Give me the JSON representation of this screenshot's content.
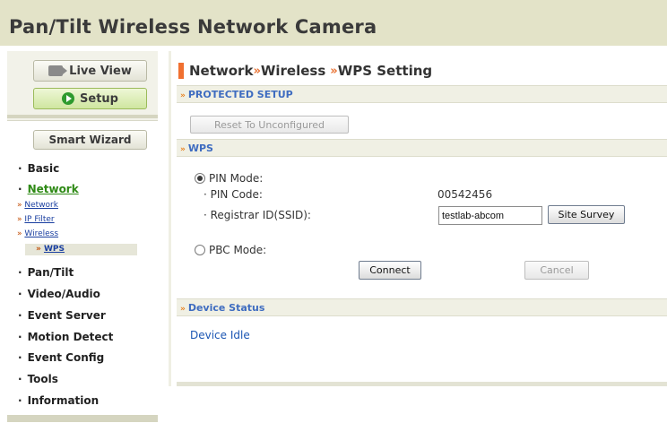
{
  "header": {
    "title": "Pan/Tilt Wireless Network Camera"
  },
  "sidebar": {
    "live_view": "Live View",
    "setup": "Setup",
    "smart_wizard": "Smart Wizard",
    "items": [
      {
        "label": "Basic"
      },
      {
        "label": "Network"
      },
      {
        "label": "Pan/Tilt"
      },
      {
        "label": "Video/Audio"
      },
      {
        "label": "Event Server"
      },
      {
        "label": "Motion Detect"
      },
      {
        "label": "Event Config"
      },
      {
        "label": "Tools"
      },
      {
        "label": "Information"
      }
    ],
    "bullet": "·",
    "sub_arrow": "»",
    "network_sub": [
      {
        "label": "Network"
      },
      {
        "label": "IP Filter"
      },
      {
        "label": "Wireless"
      }
    ],
    "wps": "WPS"
  },
  "main": {
    "breadcrumb": {
      "a": "Network",
      "b": "Wireless",
      "c": "WPS Setting",
      "sep": "»"
    },
    "sections": {
      "protected": "PROTECTED SETUP",
      "wps": "WPS",
      "device_status": "Device Status",
      "arrow": "»"
    },
    "reset_button": "Reset To Unconfigured",
    "pin_mode": "PIN Mode:",
    "pin_code_label": "· PIN Code:",
    "pin_code_value": "00542456",
    "registrar_label": "· Registrar ID(SSID):",
    "registrar_value": "testlab-abcom",
    "site_survey": "Site Survey",
    "pbc_mode": "PBC Mode:",
    "connect": "Connect",
    "cancel": "Cancel",
    "device_status_text": "Device Idle"
  },
  "colors": {
    "accent_orange": "#f07030",
    "link_blue": "#1b56b3",
    "active_green": "#2f8a16"
  }
}
